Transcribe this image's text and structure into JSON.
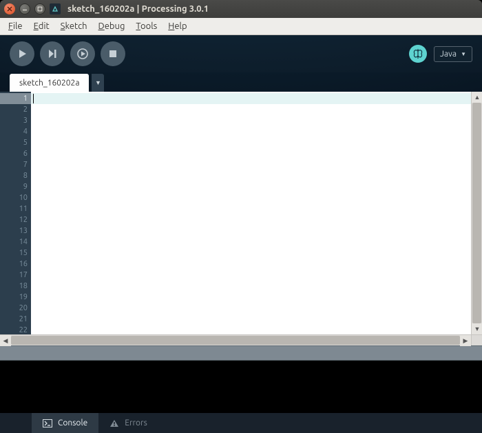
{
  "window": {
    "title": "sketch_160202a | Processing 3.0.1"
  },
  "menubar": {
    "items": [
      {
        "pre": "",
        "u": "F",
        "post": "ile"
      },
      {
        "pre": "",
        "u": "E",
        "post": "dit"
      },
      {
        "pre": "",
        "u": "S",
        "post": "ketch"
      },
      {
        "pre": "",
        "u": "D",
        "post": "ebug"
      },
      {
        "pre": "",
        "u": "T",
        "post": "ools"
      },
      {
        "pre": "",
        "u": "H",
        "post": "elp"
      }
    ]
  },
  "toolbar": {
    "mode_label": "Java"
  },
  "tabs": {
    "active": {
      "label": "sketch_160202a"
    }
  },
  "editor": {
    "line_count": 22,
    "active_line": 1
  },
  "bottom_tabs": {
    "console_label": "Console",
    "errors_label": "Errors"
  }
}
